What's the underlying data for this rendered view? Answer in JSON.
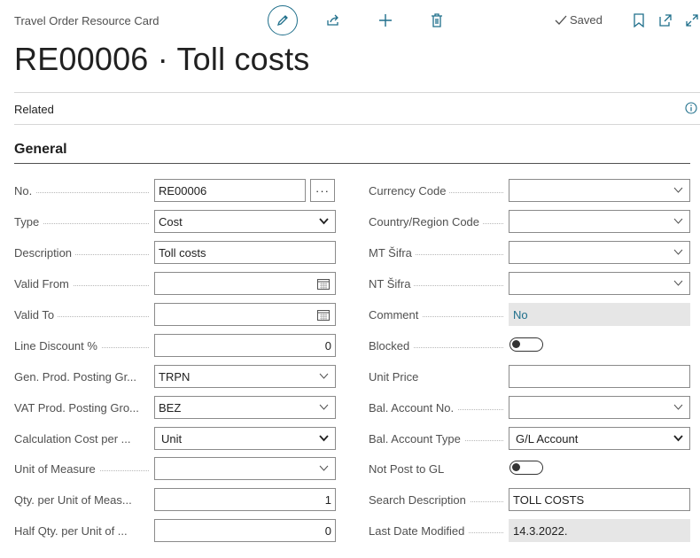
{
  "header": {
    "page_type": "Travel Order Resource Card",
    "saved_label": "Saved",
    "title": "RE00006 · Toll costs"
  },
  "actions": {
    "edit": "pencil-icon",
    "share": "share-icon",
    "new": "plus-icon",
    "delete": "trash-icon",
    "bookmark": "bookmark-icon",
    "open_new_window": "open-window-icon",
    "expand": "expand-icon"
  },
  "related_label": "Related",
  "group_title": "General",
  "left": {
    "no": {
      "label": "No.",
      "value": "RE00006"
    },
    "type": {
      "label": "Type",
      "value": "Cost"
    },
    "description": {
      "label": "Description",
      "value": "Toll costs"
    },
    "valid_from": {
      "label": "Valid From",
      "value": ""
    },
    "valid_to": {
      "label": "Valid To",
      "value": ""
    },
    "line_discount": {
      "label": "Line Discount %",
      "value": "0"
    },
    "gen_prod": {
      "label": "Gen. Prod. Posting Gr...",
      "value": "TRPN"
    },
    "vat_prod": {
      "label": "VAT Prod. Posting Gro...",
      "value": "BEZ"
    },
    "calc_cost": {
      "label": "Calculation Cost per ...",
      "value": "Unit"
    },
    "uom": {
      "label": "Unit of Measure",
      "value": ""
    },
    "qty_per_uom": {
      "label": "Qty. per Unit of Meas...",
      "value": "1"
    },
    "half_qty": {
      "label": "Half Qty. per Unit of ...",
      "value": "0"
    }
  },
  "right": {
    "currency": {
      "label": "Currency Code",
      "value": ""
    },
    "country": {
      "label": "Country/Region Code",
      "value": ""
    },
    "mt_sifra": {
      "label": "MT Šifra",
      "value": ""
    },
    "nt_sifra": {
      "label": "NT Šifra",
      "value": ""
    },
    "comment": {
      "label": "Comment",
      "value": "No"
    },
    "blocked": {
      "label": "Blocked",
      "value": false
    },
    "unit_price": {
      "label": "Unit Price",
      "value": ""
    },
    "bal_acc_no": {
      "label": "Bal. Account No.",
      "value": ""
    },
    "bal_acc_type": {
      "label": "Bal. Account Type",
      "value": "G/L Account"
    },
    "not_post": {
      "label": "Not Post to GL",
      "value": false
    },
    "search_desc": {
      "label": "Search Description",
      "value": "TOLL COSTS"
    },
    "last_modified": {
      "label": "Last Date Modified",
      "value": "14.3.2022."
    }
  },
  "colors": {
    "accent": "#1f6f8b",
    "readonly_bg": "#e6e6e6",
    "border": "#8a8a8a"
  }
}
